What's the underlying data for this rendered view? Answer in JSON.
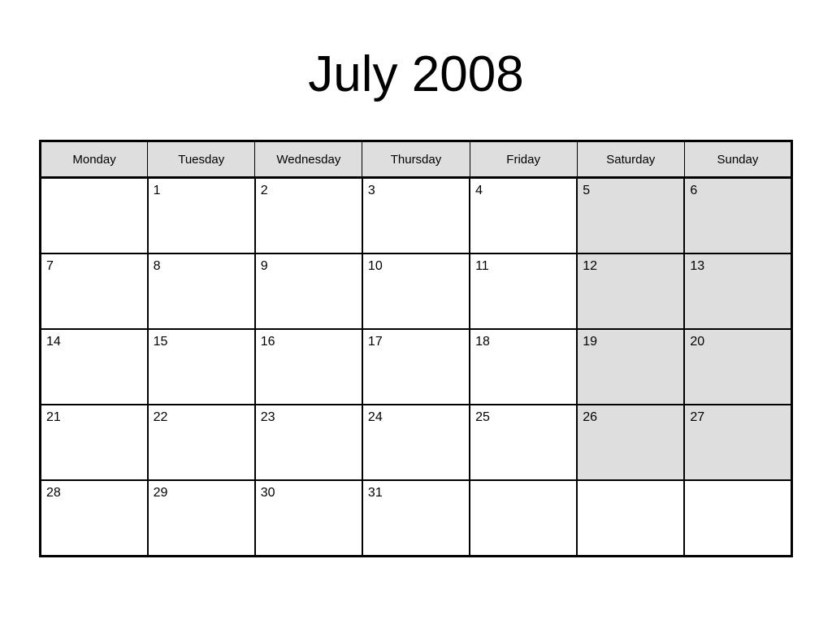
{
  "document": {
    "title": "July 2008",
    "month": "July",
    "year": "2008"
  },
  "colors": {
    "page_background": "#ffffff",
    "text": "#000000",
    "grid_line": "#000000",
    "header_background": "#dedede",
    "weekend_background": "#dedede",
    "day_cell_background": "#ffffff"
  },
  "calendar": {
    "columns": [
      {
        "label": "Monday",
        "weekend": false
      },
      {
        "label": "Tuesday",
        "weekend": false
      },
      {
        "label": "Wednesday",
        "weekend": false
      },
      {
        "label": "Thursday",
        "weekend": false
      },
      {
        "label": "Friday",
        "weekend": false
      },
      {
        "label": "Saturday",
        "weekend": true
      },
      {
        "label": "Sunday",
        "weekend": true
      }
    ],
    "weeks": [
      {
        "cells": [
          {
            "day": "",
            "shaded": false
          },
          {
            "day": "1",
            "shaded": false
          },
          {
            "day": "2",
            "shaded": false
          },
          {
            "day": "3",
            "shaded": false
          },
          {
            "day": "4",
            "shaded": false
          },
          {
            "day": "5",
            "shaded": true
          },
          {
            "day": "6",
            "shaded": true
          }
        ]
      },
      {
        "cells": [
          {
            "day": "7",
            "shaded": false
          },
          {
            "day": "8",
            "shaded": false
          },
          {
            "day": "9",
            "shaded": false
          },
          {
            "day": "10",
            "shaded": false
          },
          {
            "day": "11",
            "shaded": false
          },
          {
            "day": "12",
            "shaded": true
          },
          {
            "day": "13",
            "shaded": true
          }
        ]
      },
      {
        "cells": [
          {
            "day": "14",
            "shaded": false
          },
          {
            "day": "15",
            "shaded": false
          },
          {
            "day": "16",
            "shaded": false
          },
          {
            "day": "17",
            "shaded": false
          },
          {
            "day": "18",
            "shaded": false
          },
          {
            "day": "19",
            "shaded": true
          },
          {
            "day": "20",
            "shaded": true
          }
        ]
      },
      {
        "cells": [
          {
            "day": "21",
            "shaded": false
          },
          {
            "day": "22",
            "shaded": false
          },
          {
            "day": "23",
            "shaded": false
          },
          {
            "day": "24",
            "shaded": false
          },
          {
            "day": "25",
            "shaded": false
          },
          {
            "day": "26",
            "shaded": true
          },
          {
            "day": "27",
            "shaded": true
          }
        ]
      },
      {
        "cells": [
          {
            "day": "28",
            "shaded": false
          },
          {
            "day": "29",
            "shaded": false
          },
          {
            "day": "30",
            "shaded": false
          },
          {
            "day": "31",
            "shaded": false
          },
          {
            "day": "",
            "shaded": false
          },
          {
            "day": "",
            "shaded": false
          },
          {
            "day": "",
            "shaded": false
          }
        ]
      }
    ]
  }
}
